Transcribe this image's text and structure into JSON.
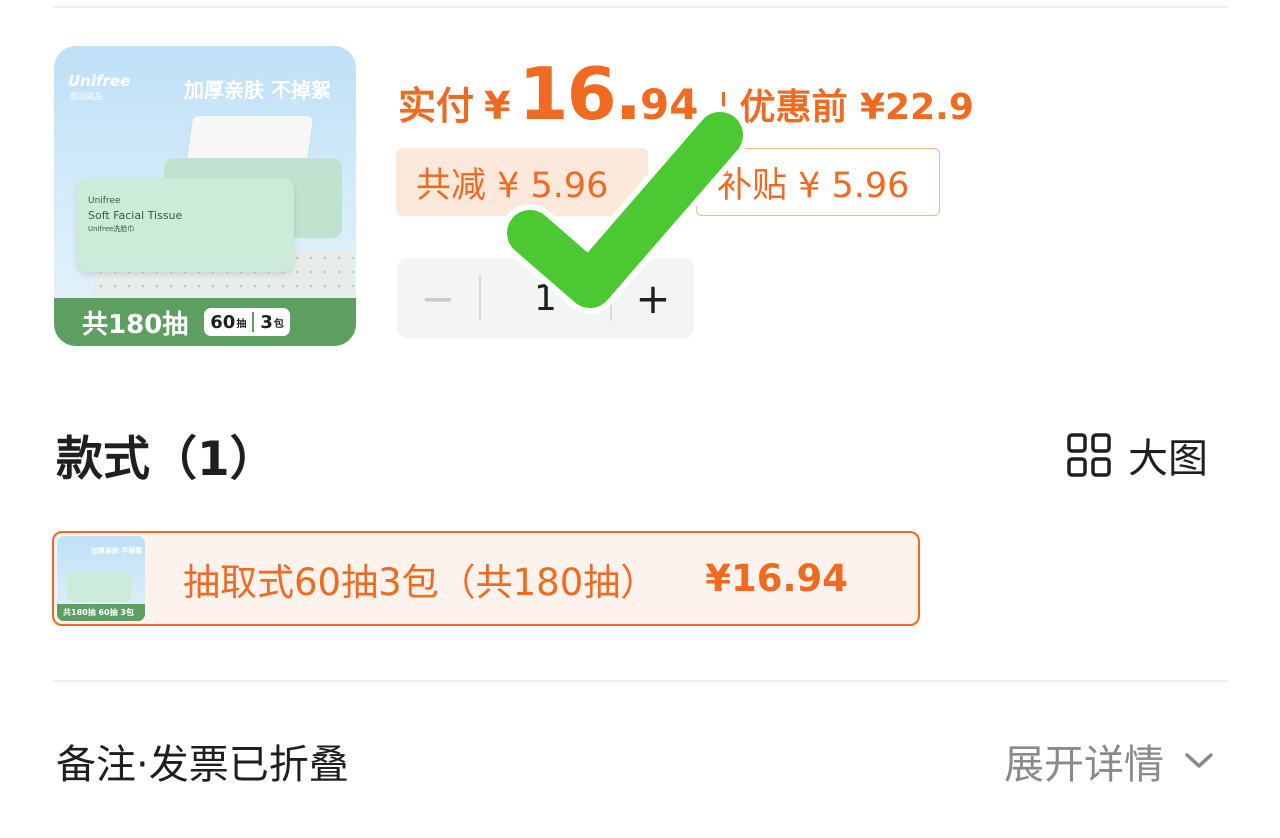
{
  "product": {
    "thumbnail": {
      "brand": "Unifree",
      "brand_sub": "悠润威品",
      "slogan": "加厚亲肤 不掉絮",
      "pack_label": "Unifree",
      "pack_title": "Soft Facial Tissue",
      "pack_sub": "Unifree洗脸巾",
      "total": "共180抽",
      "chip_count": "60",
      "chip_count_unit": "抽",
      "chip_packs": "3",
      "chip_packs_unit": "包"
    },
    "price": {
      "label": "实付",
      "currency": "¥",
      "integer": "16.",
      "decimal": "94",
      "original_label": "优惠前 ¥22.9"
    },
    "discount_total": "共减 ¥ 5.96",
    "subsidy": "补贴 ¥ 5.96",
    "quantity": {
      "minus": "−",
      "value": "1",
      "plus": "+"
    }
  },
  "styles": {
    "title": "款式（1）",
    "big_view_label": "大图",
    "options": [
      {
        "thumb_slogan": "加厚亲肤 不掉絮",
        "thumb_band": "共180抽 60抽 3包",
        "name": "抽取式60抽3包（共180抽）",
        "price": "¥16.94"
      }
    ]
  },
  "footer": {
    "left": "备注·发票已折叠",
    "right": "展开详情"
  },
  "colors": {
    "accent": "#f06a22",
    "check": "#4cc832",
    "band_green": "#5d9e61"
  },
  "icons": [
    "grid-icon",
    "chevron-down-icon",
    "checkmark-icon"
  ]
}
